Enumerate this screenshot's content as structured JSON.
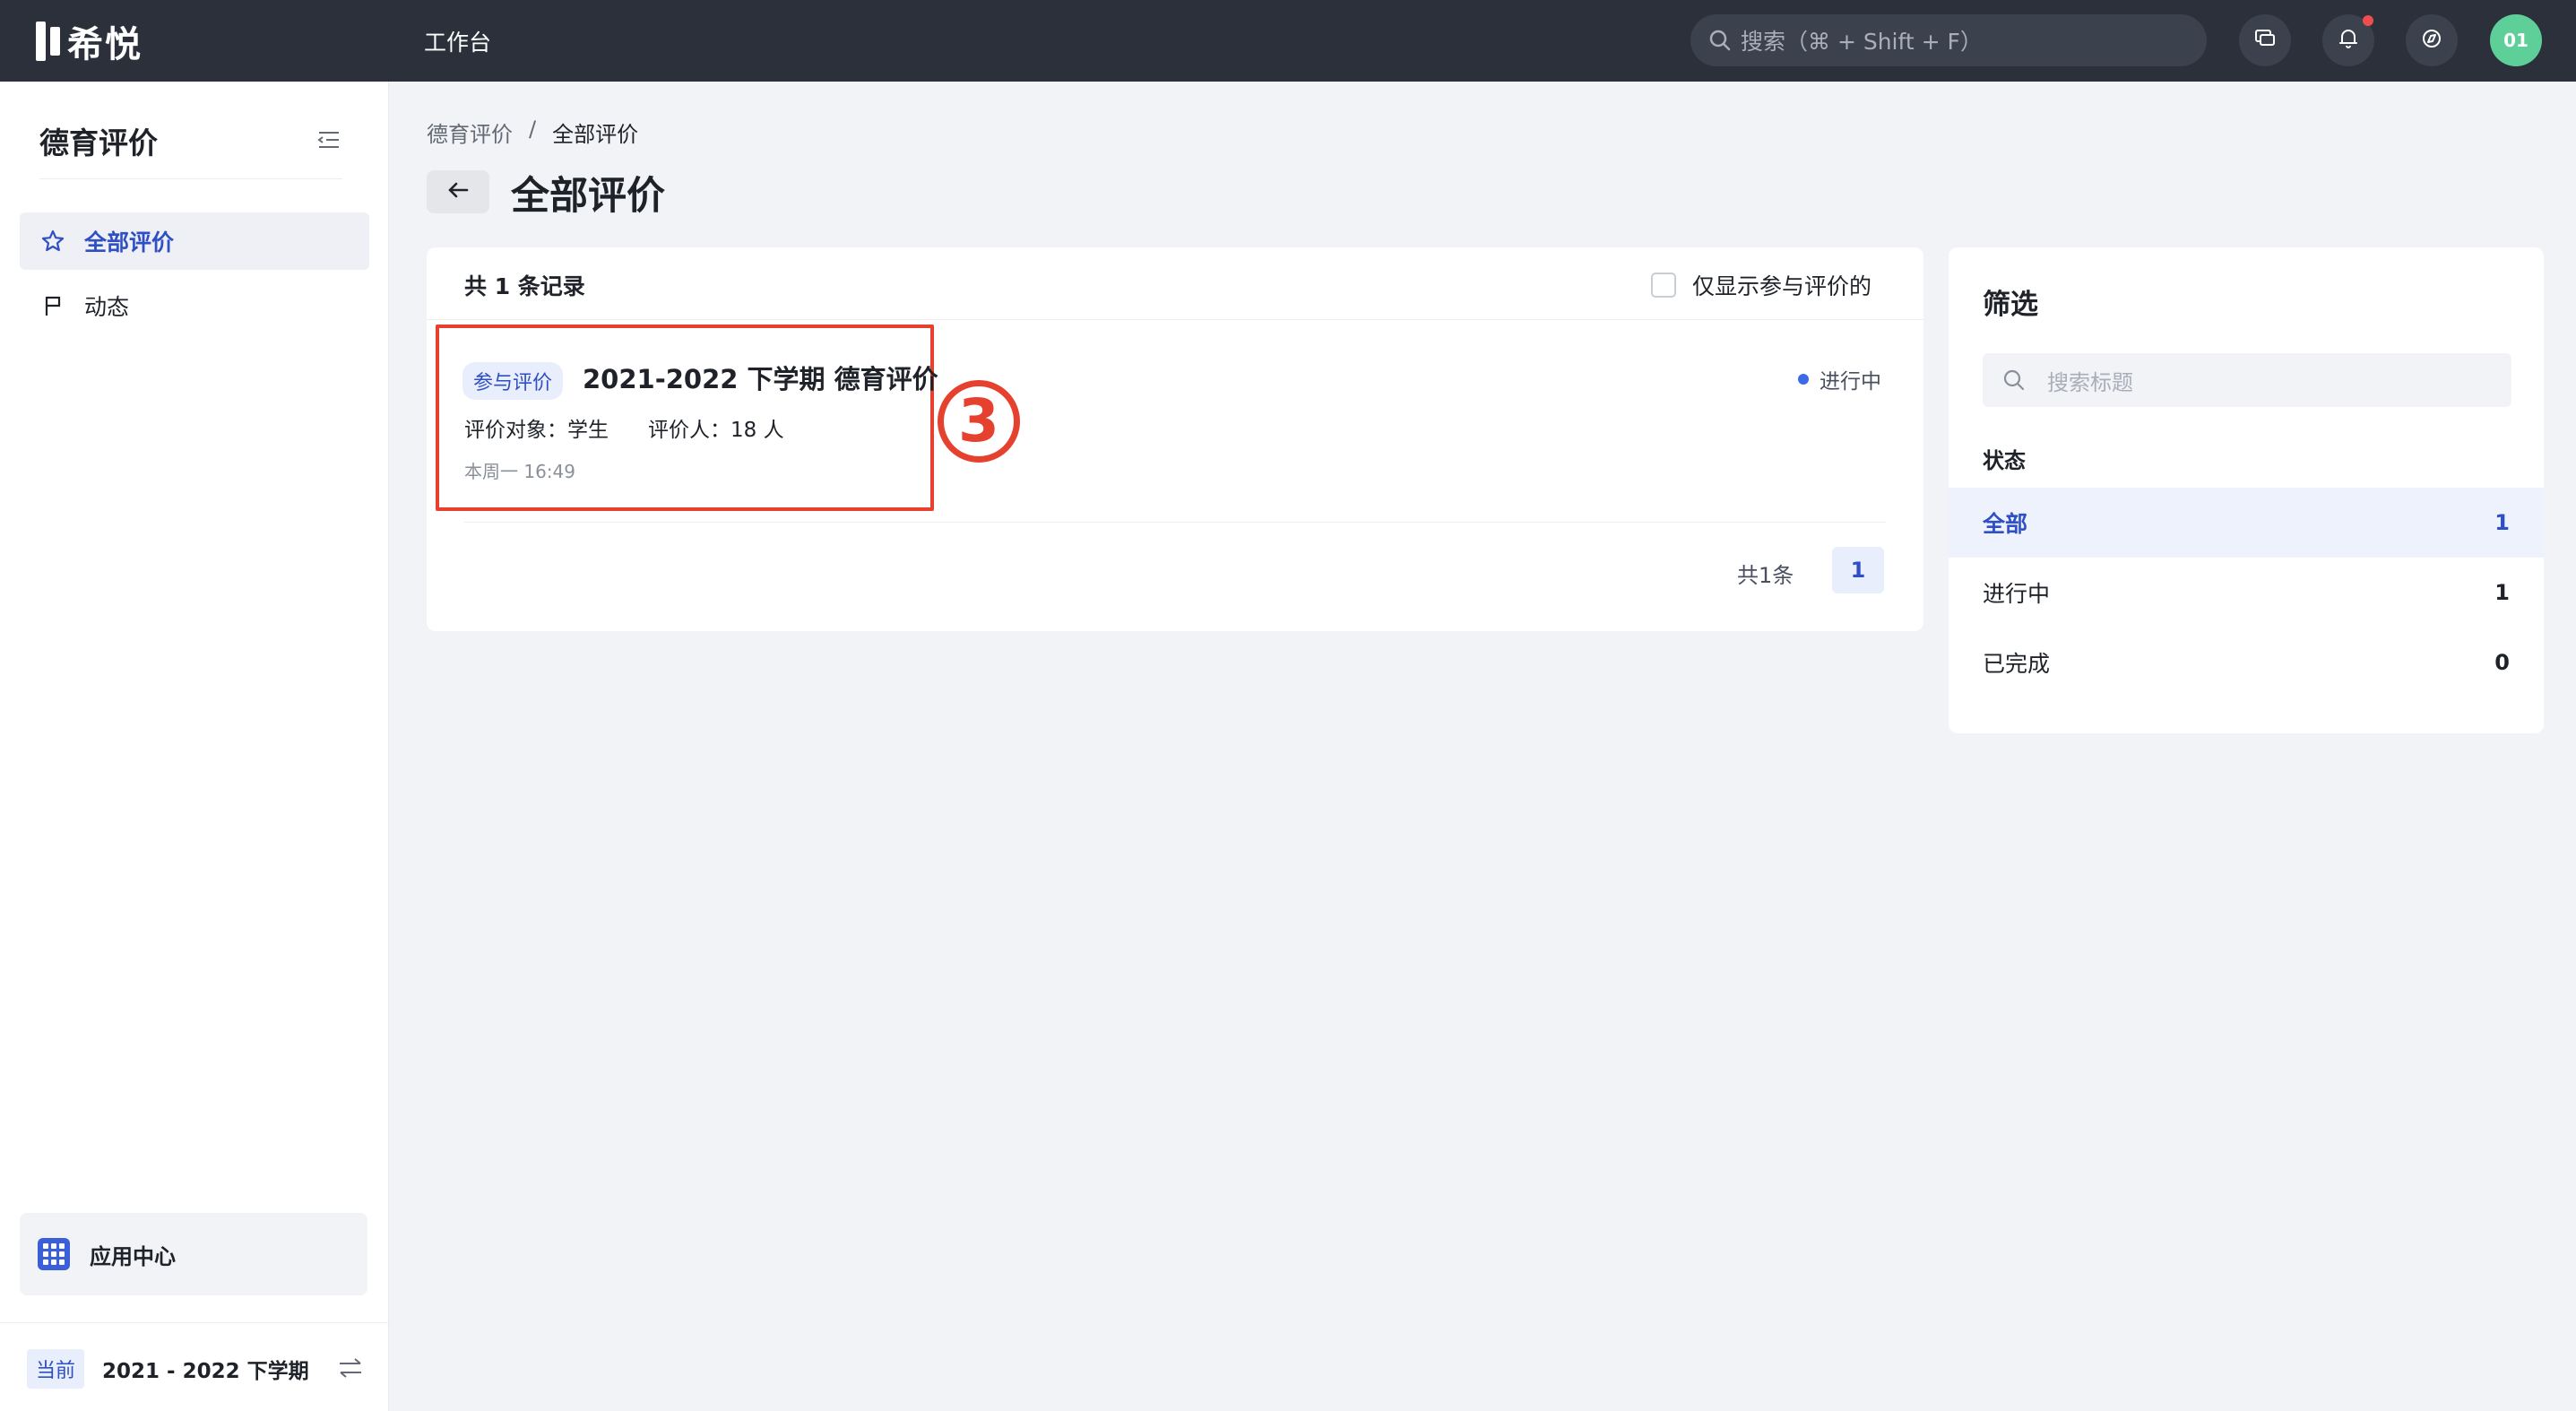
{
  "header": {
    "logo_text": "希悦",
    "nav_label": "工作台",
    "search_placeholder": "搜索（⌘ + Shift + F）",
    "avatar_text": "01"
  },
  "sidebar": {
    "title": "德育评价",
    "items": [
      {
        "label": "全部评价",
        "icon": "star-icon",
        "active": true
      },
      {
        "label": "动态",
        "icon": "flag-icon",
        "active": false
      }
    ],
    "app_center_label": "应用中心",
    "term_badge": "当前",
    "term_text": "2021 - 2022 下学期"
  },
  "main": {
    "breadcrumb": [
      "德育评价",
      "全部评价"
    ],
    "breadcrumb_sep": "/",
    "page_title": "全部评价",
    "list": {
      "summary": "共 1 条记录",
      "only_mine_label": "仅显示参与评价的",
      "records": [
        {
          "tag": "参与评价",
          "title": "2021-2022 下学期 德育评价",
          "target": "评价对象：学生",
          "evaluators": "评价人：18 人",
          "time": "本周一 16:49",
          "status": "进行中"
        }
      ],
      "pager_total": "共1条",
      "current_page": "1"
    },
    "step_marker": "3"
  },
  "filter": {
    "title": "筛选",
    "search_placeholder": "搜索标题",
    "status_label": "状态",
    "statuses": [
      {
        "label": "全部",
        "count": "1",
        "active": true
      },
      {
        "label": "进行中",
        "count": "1",
        "active": false
      },
      {
        "label": "已完成",
        "count": "0",
        "active": false
      }
    ]
  },
  "colors": {
    "topbar": "#2b303b",
    "accent": "#2f4fc4",
    "annotation_red": "#e5412e",
    "avatar": "#5fcf9a"
  }
}
